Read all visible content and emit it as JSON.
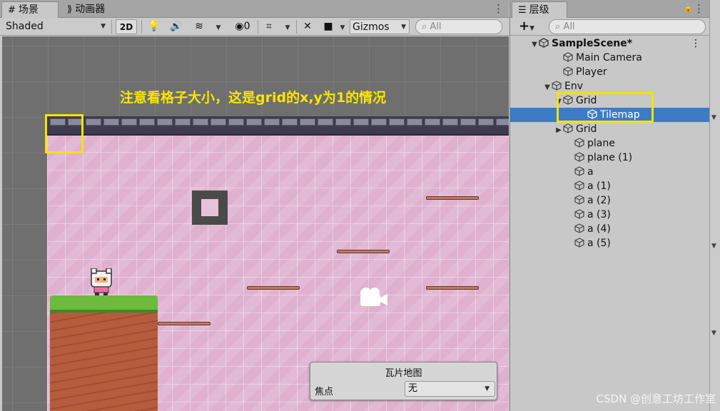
{
  "scene_tabs": [
    {
      "label": "场景",
      "icon": "grid-icon"
    },
    {
      "label": "动画器",
      "icon": "animator-icon"
    }
  ],
  "toolbar": {
    "shading_mode": "Shaded",
    "mode_2d": "2D",
    "hidden_count": "0",
    "gizmos": "Gizmos",
    "search_placeholder": "All"
  },
  "annotation": "注意看格子大小，这是grid的x,y为1的情况",
  "overlay": {
    "title": "瓦片地图",
    "focus_label": "焦点",
    "focus_value": "无"
  },
  "hierarchy": {
    "tab_label": "层级",
    "search_placeholder": "All",
    "add_label": "+",
    "rows": [
      {
        "label": "SampleScene*",
        "bold": true
      },
      {
        "label": "Main Camera"
      },
      {
        "label": "Player"
      },
      {
        "label": "Env"
      },
      {
        "label": "Grid"
      },
      {
        "label": "Tilemap",
        "selected": true
      },
      {
        "label": "Grid"
      },
      {
        "label": "plane"
      },
      {
        "label": "plane (1)"
      },
      {
        "label": "a"
      },
      {
        "label": "a (1)"
      },
      {
        "label": "a (2)"
      },
      {
        "label": "a (3)"
      },
      {
        "label": "a (4)"
      },
      {
        "label": "a (5)"
      }
    ]
  },
  "watermark": "CSDN @创意工坊工作室",
  "colors": {
    "selection": "#3e7bc7",
    "highlight": "#f4e400",
    "tile_pink": "#dfb1cf"
  }
}
